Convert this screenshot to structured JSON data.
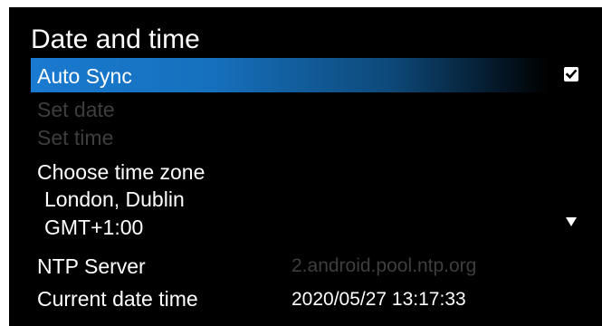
{
  "screen": {
    "title": "Date and time"
  },
  "items": {
    "auto_sync": {
      "label": "Auto Sync",
      "checked": true,
      "icon": "checkbox-checked-icon"
    },
    "set_date": {
      "label": "Set date",
      "enabled": false
    },
    "set_time": {
      "label": "Set time",
      "enabled": false
    },
    "time_zone": {
      "label": "Choose time zone",
      "city": "London, Dublin",
      "offset": "GMT+1:00",
      "icon": "dropdown-arrow-icon"
    },
    "ntp_server": {
      "label": "NTP Server",
      "value": "2.android.pool.ntp.org"
    },
    "current_date_time": {
      "label": "Current date time",
      "value": "2020/05/27 13:17:33"
    }
  },
  "colors": {
    "background": "#000000",
    "highlight": "#1a7ad0",
    "text": "#ffffff",
    "disabled_text": "#3e3e3e"
  }
}
